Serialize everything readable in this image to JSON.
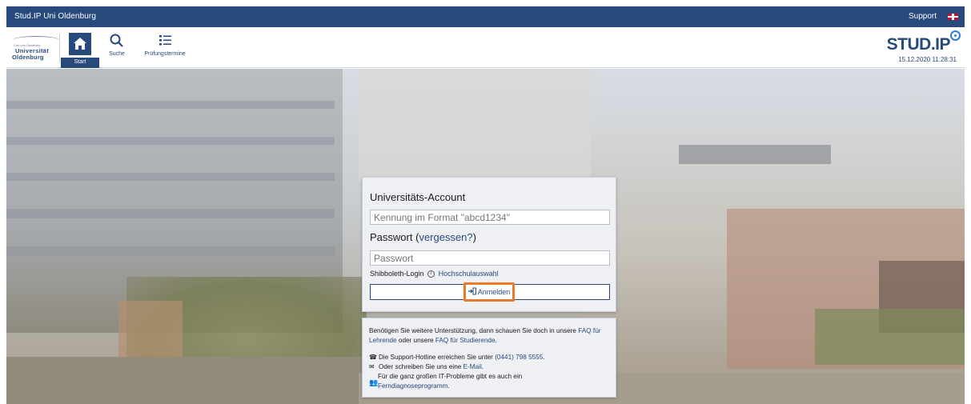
{
  "topbar": {
    "title": "Stud.IP Uni Oldenburg",
    "support": "Support",
    "language_flag_icon": "uk-flag-icon"
  },
  "university_logo": {
    "line1": "Carl von Ossietzky",
    "line2": "Universität",
    "line3": "Oldenburg"
  },
  "nav": {
    "items": [
      {
        "label": "Start",
        "icon": "home-icon",
        "active": true
      },
      {
        "label": "Suche",
        "icon": "search-icon"
      },
      {
        "label": "Prüfungstermine",
        "icon": "list-icon"
      }
    ]
  },
  "brand": {
    "logo_text": "STUD.IP",
    "datetime": "15.12.2020 11:28:31"
  },
  "login": {
    "title": "Universitäts-Account",
    "username_placeholder": "Kennung im Format \"abcd1234\"",
    "password_label": "Passwort",
    "forgot_prefix": "(",
    "forgot_link": "vergessen?",
    "forgot_suffix": ")",
    "password_placeholder": "Passwort",
    "shibboleth_label": "Shibboleth-Login",
    "shibboleth_link": "Hochschulauswahl",
    "submit": "Anmelden"
  },
  "help": {
    "p1_text1": "Benötigen Sie weitere Unterstützung, dann schauen Sie doch in unsere ",
    "p1_link1": "FAQ für Lehrende",
    "p1_text2": " oder unsere ",
    "p1_link2": "FAQ für Studierende",
    "p1_text3": ".",
    "hotline_text": "Die Support-Hotline erreichen Sie unter ",
    "hotline_number": "(0441) 798 5555",
    "hotline_end": ".",
    "mail_text": "Oder schreiben Sie uns eine ",
    "mail_link": "E-Mail",
    "mail_end": ".",
    "remote_text": "Für die ganz großen IT-Probleme gibt es auch ein",
    "remote_link": "Ferndiagnoseprogramm",
    "remote_end": "."
  },
  "colors": {
    "brand_blue": "#28497c",
    "highlight_orange": "#e87a2b"
  }
}
